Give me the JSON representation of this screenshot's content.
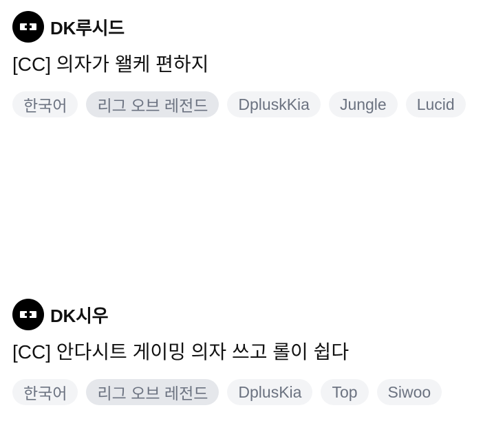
{
  "feed": {
    "items": [
      {
        "channel": "DK루시드",
        "avatar_icon": "dk-logo-icon",
        "title": "[CC] 의자가 왤케 편하지",
        "tags": [
          "한국어",
          "리그 오브 레전드",
          "DpluskKia",
          "Jungle",
          "Lucid"
        ]
      },
      {
        "channel": "DK시우",
        "avatar_icon": "dk-logo-icon",
        "title": "[CC] 안다시트 게이밍 의자 쓰고 롤이 쉽다",
        "tags": [
          "한국어",
          "리그 오브 레전드",
          "DplusKia",
          "Top",
          "Siwoo"
        ]
      }
    ]
  },
  "colors": {
    "tag_background": "#f3f4f6",
    "tag_background_selected": "#e5e7eb",
    "tag_text": "#6b7280",
    "title_text": "#111111"
  }
}
